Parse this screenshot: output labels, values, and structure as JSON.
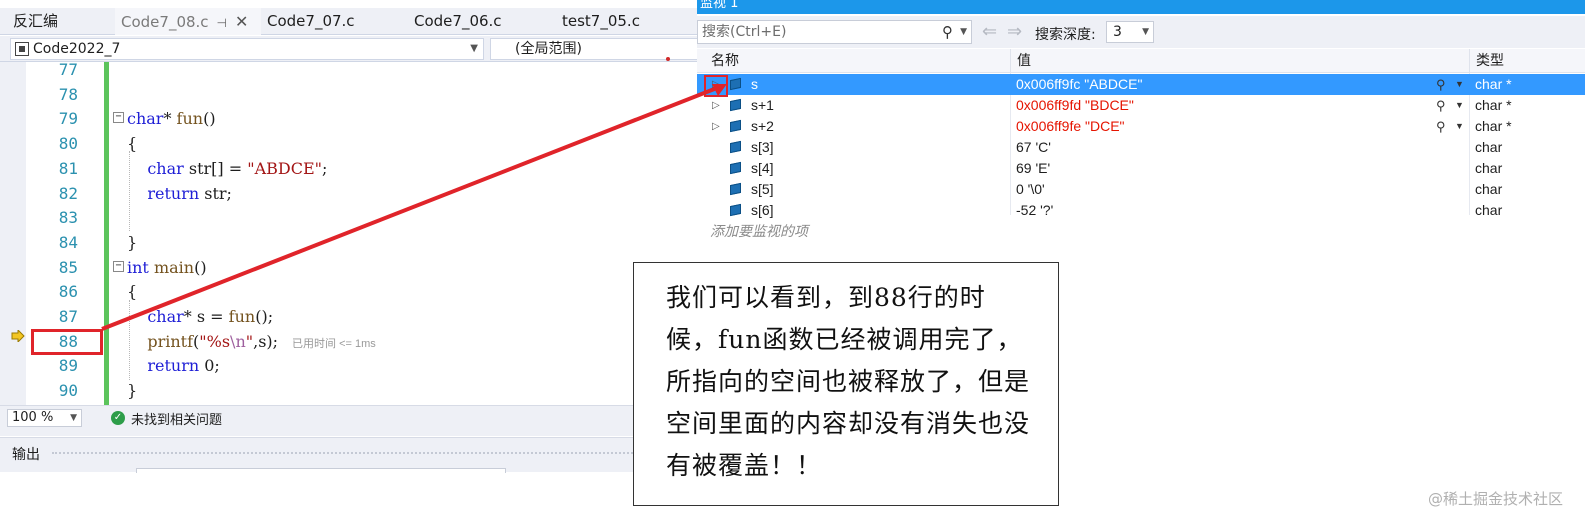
{
  "tabs": [
    {
      "label": "反汇编",
      "active": false
    },
    {
      "label": "Code7_08.c",
      "active": true
    },
    {
      "label": "Code7_07.c",
      "active": false
    },
    {
      "label": "Code7_06.c",
      "active": false
    },
    {
      "label": "test7_05.c",
      "active": false
    }
  ],
  "tab_pin_glyph": "⊣",
  "tab_close_glyph": "✕",
  "nav": {
    "project": "Code2022_7",
    "scope": "(全局范围)"
  },
  "code_lines": [
    {
      "n": "77",
      "parts": []
    },
    {
      "n": "78",
      "parts": []
    },
    {
      "n": "79",
      "parts": [
        [
          "kw",
          "char"
        ],
        [
          "",
          "* "
        ],
        [
          "fn",
          "fun"
        ],
        [
          "",
          "()"
        ]
      ]
    },
    {
      "n": "80",
      "parts": [
        [
          "",
          "{"
        ]
      ]
    },
    {
      "n": "81",
      "parts": [
        [
          "",
          "    "
        ],
        [
          "kw",
          "char"
        ],
        [
          "",
          " str[] = "
        ],
        [
          "str",
          "\"ABDCE\""
        ],
        [
          "",
          ";"
        ]
      ]
    },
    {
      "n": "82",
      "parts": [
        [
          "",
          "    "
        ],
        [
          "kw",
          "return"
        ],
        [
          "",
          " str;"
        ]
      ]
    },
    {
      "n": "83",
      "parts": []
    },
    {
      "n": "84",
      "parts": [
        [
          "",
          "}"
        ]
      ]
    },
    {
      "n": "85",
      "parts": [
        [
          "kw",
          "int"
        ],
        [
          "",
          " "
        ],
        [
          "fn",
          "main"
        ],
        [
          "",
          "()"
        ]
      ]
    },
    {
      "n": "86",
      "parts": [
        [
          "",
          "{"
        ]
      ]
    },
    {
      "n": "87",
      "parts": [
        [
          "",
          "    "
        ],
        [
          "kw",
          "char"
        ],
        [
          "",
          "* s = "
        ],
        [
          "fn",
          "fun"
        ],
        [
          "",
          "();"
        ]
      ]
    },
    {
      "n": "88",
      "parts": [
        [
          "",
          "    "
        ],
        [
          "fn",
          "printf"
        ],
        [
          "",
          "("
        ],
        [
          "str",
          "\"%s"
        ],
        [
          "esc",
          "\\n"
        ],
        [
          "str",
          "\""
        ],
        [
          "",
          ",s);"
        ]
      ]
    },
    {
      "n": "89",
      "parts": [
        [
          "",
          "    "
        ],
        [
          "kw",
          "return"
        ],
        [
          "",
          " 0;"
        ]
      ]
    },
    {
      "n": "90",
      "parts": [
        [
          "",
          "}"
        ]
      ]
    }
  ],
  "elapsed_hint": "已用时间 <= 1ms",
  "status": {
    "zoom": "100 %",
    "issues": "未找到相关问题"
  },
  "output_title": "输出",
  "watch": {
    "title": "监视 1",
    "search_placeholder": "搜索(Ctrl+E)",
    "depth_label": "搜索深度:",
    "depth_value": "3",
    "columns": [
      "名称",
      "值",
      "类型"
    ],
    "rows": [
      {
        "name": "s",
        "value": "0x006ff9fc \"ABDCE\"",
        "type": "char *",
        "expandable": true,
        "changed": false,
        "selected": true,
        "viewer": true
      },
      {
        "name": "s+1",
        "value": "0x006ff9fd \"BDCE\"",
        "type": "char *",
        "expandable": true,
        "changed": true,
        "selected": false,
        "viewer": true
      },
      {
        "name": "s+2",
        "value": "0x006ff9fe \"DCE\"",
        "type": "char *",
        "expandable": true,
        "changed": true,
        "selected": false,
        "viewer": true
      },
      {
        "name": "s[3]",
        "value": "67 'C'",
        "type": "char",
        "expandable": false,
        "changed": false,
        "selected": false,
        "viewer": false
      },
      {
        "name": "s[4]",
        "value": "69 'E'",
        "type": "char",
        "expandable": false,
        "changed": false,
        "selected": false,
        "viewer": false
      },
      {
        "name": "s[5]",
        "value": "0 '\\0'",
        "type": "char",
        "expandable": false,
        "changed": false,
        "selected": false,
        "viewer": false
      },
      {
        "name": "s[6]",
        "value": "-52 '?'",
        "type": "char",
        "expandable": false,
        "changed": false,
        "selected": false,
        "viewer": false
      }
    ],
    "add_item": "添加要监视的项"
  },
  "callout": "我们可以看到，到88行的时候，fun函数已经被调用完了，所指向的空间也被释放了，但是空间里面的内容却没有消失也没有被覆盖！！",
  "watermark": "@稀土掘金技术社区",
  "colors": {
    "accent": "#1c97ea",
    "selection": "#3399ff",
    "changed_value": "#e51400",
    "annotation_red": "#e0242a",
    "keyword": "#1f1fd6"
  }
}
